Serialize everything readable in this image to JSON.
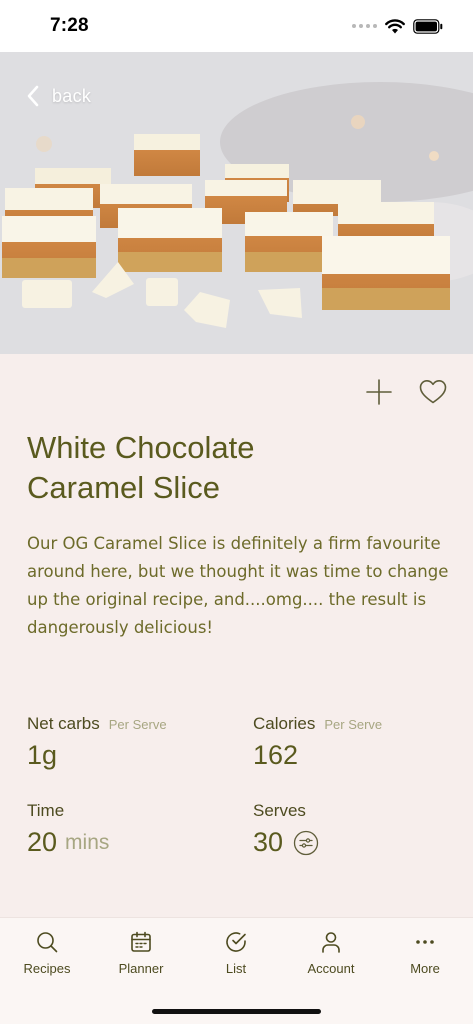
{
  "status_bar": {
    "time": "7:28"
  },
  "hero": {
    "back_label": "back"
  },
  "recipe": {
    "title_line1": "White Chocolate",
    "title_line2": "Caramel Slice",
    "description": "Our OG Caramel Slice is definitely a firm favourite around here, but we thought it was time to change up the original recipe, and....omg.... the result is dangerously delicious!"
  },
  "stats": {
    "net_carbs": {
      "label": "Net carbs",
      "sub": "Per Serve",
      "value": "1g"
    },
    "calories": {
      "label": "Calories",
      "sub": "Per Serve",
      "value": "162"
    },
    "time": {
      "label": "Time",
      "value": "20",
      "unit": "mins"
    },
    "serves": {
      "label": "Serves",
      "value": "30"
    }
  },
  "tabbar": {
    "items": [
      {
        "label": "Recipes",
        "icon": "search-icon"
      },
      {
        "label": "Planner",
        "icon": "calendar-icon"
      },
      {
        "label": "List",
        "icon": "check-circle-icon"
      },
      {
        "label": "Account",
        "icon": "person-icon"
      },
      {
        "label": "More",
        "icon": "more-dots-icon"
      }
    ]
  },
  "colors": {
    "accent": "#5a5a1e",
    "muted": "#a7a682",
    "background": "#f7eeec"
  }
}
